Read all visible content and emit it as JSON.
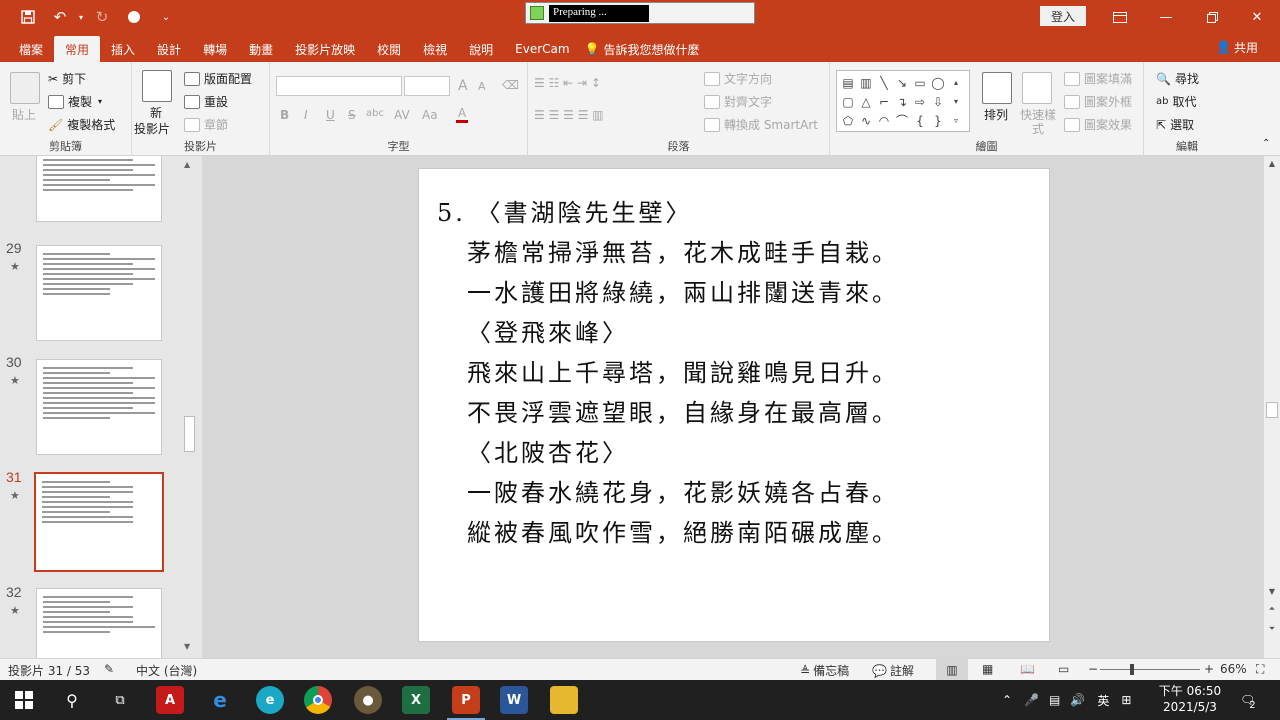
{
  "titlebar": {
    "preparing_text": "Preparing ...",
    "signin_label": "登入"
  },
  "tabs": [
    {
      "label": "檔案"
    },
    {
      "label": "常用"
    },
    {
      "label": "插入"
    },
    {
      "label": "設計"
    },
    {
      "label": "轉場"
    },
    {
      "label": "動畫"
    },
    {
      "label": "投影片放映"
    },
    {
      "label": "校閱"
    },
    {
      "label": "檢視"
    },
    {
      "label": "說明"
    },
    {
      "label": "EverCam"
    }
  ],
  "tell_me": "告訴我您想做什麼",
  "share_label": "共用",
  "ribbon": {
    "clipboard": {
      "paste": "貼上",
      "cut": "剪下",
      "copy": "複製",
      "format_painter": "複製格式",
      "label": "剪貼簿"
    },
    "slides": {
      "new_slide_1": "新",
      "new_slide_2": "投影片",
      "layout": "版面配置",
      "reset": "重設",
      "section": "章節",
      "label": "投影片"
    },
    "font": {
      "label": "字型",
      "bold": "B",
      "italic": "I",
      "underline": "U",
      "strike": "S",
      "shadow": "abc",
      "spacing": "AV",
      "case": "Aa",
      "grow": "A",
      "shrink": "A"
    },
    "paragraph": {
      "text_direction": "文字方向",
      "align_text": "對齊文字",
      "smartart": "轉換成 SmartArt",
      "label": "段落"
    },
    "drawing": {
      "arrange": "排列",
      "quick_styles_1": "快速樣",
      "quick_styles_2": "式",
      "fill": "圖案填滿",
      "outline": "圖案外框",
      "effects": "圖案效果",
      "label": "繪圖"
    },
    "editing": {
      "find": "尋找",
      "replace": "取代",
      "select": "選取",
      "label": "編輯"
    }
  },
  "thumbnails": [
    {
      "number": "29",
      "star": "★"
    },
    {
      "number": "30",
      "star": "★"
    },
    {
      "number": "31",
      "star": "★"
    },
    {
      "number": "32",
      "star": "★"
    }
  ],
  "slide": {
    "lines": [
      "5. 〈書湖陰先生壁〉",
      "茅檐常掃淨無苔，花木成畦手自栽。",
      "一水護田將綠繞，兩山排闥送青來。",
      "〈登飛來峰〉",
      "飛來山上千尋塔，聞說雞鳴見日升。",
      "不畏浮雲遮望眼，自緣身在最高層。",
      "〈北陂杏花〉",
      "一陂春水繞花身，花影妖嬈各占春。",
      "縱被春風吹作雪，絕勝南陌碾成塵。"
    ]
  },
  "statusbar": {
    "slide_counter": "投影片 31 / 53",
    "language": "中文 (台灣)",
    "notes": "備忘稿",
    "comments": "註解",
    "zoom": "66%",
    "minus": "−",
    "plus": "+"
  },
  "taskbar": {
    "lang_indicator": "英",
    "time": "下午 06:50",
    "date": "2021/5/3",
    "notification_count": "2"
  },
  "colors": {
    "accent": "#c43e1c",
    "taskbar": "#202020"
  }
}
